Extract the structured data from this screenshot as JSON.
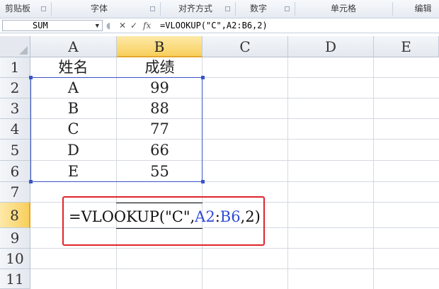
{
  "ribbon": {
    "groups": [
      "剪贴板",
      "字体",
      "对齐方式",
      "数字",
      "单元格",
      "编辑"
    ]
  },
  "formula_bar": {
    "name_box": "SUM",
    "cancel_symbol": "✕",
    "enter_symbol": "✓",
    "fx_symbol": "fx",
    "formula": "=VLOOKUP(\"C\",A2:B6,2)"
  },
  "grid": {
    "columns": [
      "A",
      "B",
      "C",
      "D",
      "E"
    ],
    "rows": [
      "1",
      "2",
      "3",
      "4",
      "5",
      "6",
      "7",
      "8",
      "9",
      "10",
      "11"
    ],
    "active_column": "B",
    "active_row": "8",
    "header_row": {
      "name": "姓名",
      "score": "成绩"
    },
    "data_rows": [
      {
        "name": "A",
        "score": "99"
      },
      {
        "name": "B",
        "score": "88"
      },
      {
        "name": "C",
        "score": "77"
      },
      {
        "name": "D",
        "score": "66"
      },
      {
        "name": "E",
        "score": "55"
      }
    ],
    "edit_cell": {
      "part1": "=VLOOKUP(",
      "part2": "\"C\",",
      "ref1": "A2",
      "colon": ":",
      "ref2": "B6",
      "part3": ",2)"
    }
  },
  "colors": {
    "selection_border": "#3a55c8",
    "highlight_box": "#e0242b",
    "active_header": "#f8cf5c",
    "reference_text": "#2f4bd8"
  }
}
